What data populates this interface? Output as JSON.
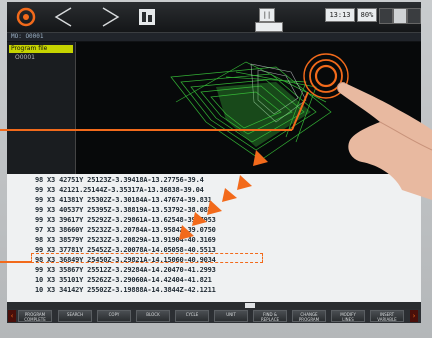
{
  "topbar": {
    "logo_icon": "gear-logo-icon",
    "back_icon": "back-arrow-icon",
    "forward_icon": "forward-arrow-icon",
    "doc_icon": "document-icon",
    "mode_label": "||",
    "time_label": "13:13",
    "percent_label": "80%"
  },
  "statusline": {
    "text": "MO: O0001"
  },
  "tree": {
    "selected": "Program file",
    "child": "O0001"
  },
  "code_lines": [
    "98 X3 42751Y 25123Z-3.39418A-13.27756-39.4",
    "99 X3 42121.25144Z-3.35317A-13.36838-39.04",
    "99 X3 41381Y 25302Z-3.30184A-13.47674-39.831",
    "99 X3 40537Y 25395Z-3.38819A-13.53792-38.087",
    "99 X3 39617Y 25292Z-3.29861A-13.62548-39.7953",
    "97 X3 38660Y 25232Z-3.20784A-13.9584Z-39.0750",
    "98 X3 38579Y 25232Z-3.20829A-13.91904-40.3169",
    "99 X3 37781Y 25452Z-3.20078A-14.05058-40.5513",
    "98 X3 36849Y 25450Z-3.29821A-14.15060-40.9034",
    "99 X3 35867Y 25512Z-3.29284A-14.20470-41.2993",
    "10 X3 35101Y 25262Z-3.29060A-14.42404-41.821",
    "10 X3 34142Y 25502Z-3.19888A-14.3844Z-42.1211"
  ],
  "softkeys": [
    "PROGRAM\nCOMPLETE",
    "SEARCH",
    "COPY",
    "BLOCK",
    "CYCLE",
    "UNIT",
    "FIND &\nREPLACE",
    "CHANGE\nPROGRAM",
    "MODIFY\nLINES",
    "INSERT\nVARIABLE"
  ],
  "colors": {
    "accent": "#f26a1b",
    "tree_selected": "#c6d400",
    "toolpath": "#38c43a"
  }
}
